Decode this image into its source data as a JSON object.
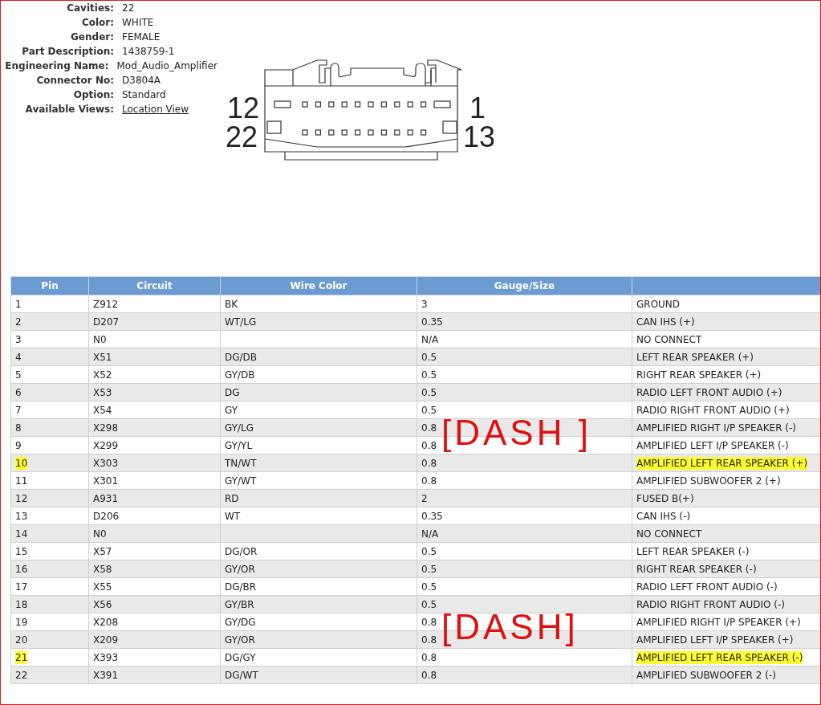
{
  "connector_info": [
    {
      "label": "Cavities:",
      "value": "22",
      "kind": "text"
    },
    {
      "label": "Color:",
      "value": "WHITE",
      "kind": "text"
    },
    {
      "label": "Gender:",
      "value": "FEMALE",
      "kind": "text"
    },
    {
      "label": "Part Description:",
      "value": "1438759-1",
      "kind": "text"
    },
    {
      "label": "Engineering Name:",
      "value": "Mod_Audio_Amplifier",
      "kind": "text"
    },
    {
      "label": "Connector No:",
      "value": "D3804A",
      "kind": "text"
    },
    {
      "label": "Option:",
      "value": "Standard",
      "kind": "text"
    },
    {
      "label": "Available Views:",
      "value": "Location View",
      "kind": "link"
    }
  ],
  "connector_diagram": {
    "pin_labels": [
      "12",
      "22",
      "1",
      "13"
    ]
  },
  "table": {
    "columns": [
      "Pin",
      "Circuit",
      "Wire Color",
      "Gauge/Size"
    ],
    "rows": [
      {
        "pin": "1",
        "circuit": "Z912",
        "wire_color": "BK",
        "gauge": "3",
        "function": "GROUND",
        "highlighted": false
      },
      {
        "pin": "2",
        "circuit": "D207",
        "wire_color": "WT/LG",
        "gauge": "0.35",
        "function": "CAN IHS (+)",
        "highlighted": false
      },
      {
        "pin": "3",
        "circuit": "N0",
        "gauge": "N/A",
        "function": "NO CONNECT",
        "highlighted": false
      },
      {
        "pin": "4",
        "circuit": "X51",
        "wire_color": "DG/DB",
        "gauge": "0.5",
        "function": "LEFT REAR SPEAKER (+)",
        "highlighted": false
      },
      {
        "pin": "5",
        "circuit": "X52",
        "wire_color": "GY/DB",
        "gauge": "0.5",
        "function": "RIGHT REAR SPEAKER (+)",
        "highlighted": false
      },
      {
        "pin": "6",
        "circuit": "X53",
        "wire_color": "DG",
        "gauge": "0.5",
        "function": "RADIO LEFT FRONT AUDIO (+)",
        "highlighted": false
      },
      {
        "pin": "7",
        "circuit": "X54",
        "wire_color": "GY",
        "gauge": "0.5",
        "function": "RADIO RIGHT FRONT AUDIO (+)",
        "highlighted": false
      },
      {
        "pin": "8",
        "circuit": "X298",
        "wire_color": "GY/LG",
        "gauge": "0.8",
        "function": "AMPLIFIED RIGHT I/P SPEAKER (-)",
        "highlighted": false,
        "annotation": "[DASH ]"
      },
      {
        "pin": "9",
        "circuit": "X299",
        "wire_color": "GY/YL",
        "gauge": "0.8",
        "function": "AMPLIFIED LEFT I/P SPEAKER (-)",
        "highlighted": false
      },
      {
        "pin": "10",
        "circuit": "X303",
        "wire_color": "TN/WT",
        "gauge": "0.8",
        "function": "AMPLIFIED LEFT REAR SPEAKER (+)",
        "highlighted": true
      },
      {
        "pin": "11",
        "circuit": "X301",
        "wire_color": "GY/WT",
        "gauge": "0.8",
        "function": "AMPLIFIED SUBWOOFER 2 (+)",
        "highlighted": false
      },
      {
        "pin": "12",
        "circuit": "A931",
        "wire_color": "RD",
        "gauge": "2",
        "function": "FUSED B(+)",
        "highlighted": false
      },
      {
        "pin": "13",
        "circuit": "D206",
        "wire_color": "WT",
        "gauge": "0.35",
        "function": "CAN IHS (-)",
        "highlighted": false
      },
      {
        "pin": "14",
        "circuit": "N0",
        "gauge": "N/A",
        "function": "NO CONNECT",
        "highlighted": false
      },
      {
        "pin": "15",
        "circuit": "X57",
        "wire_color": "DG/OR",
        "gauge": "0.5",
        "function": "LEFT REAR SPEAKER (-)",
        "highlighted": false
      },
      {
        "pin": "16",
        "circuit": "X58",
        "wire_color": "GY/OR",
        "gauge": "0.5",
        "function": "RIGHT REAR SPEAKER (-)",
        "highlighted": false
      },
      {
        "pin": "17",
        "circuit": "X55",
        "wire_color": "DG/BR",
        "gauge": "0.5",
        "function": "RADIO LEFT FRONT AUDIO (-)",
        "highlighted": false
      },
      {
        "pin": "18",
        "circuit": "X56",
        "wire_color": "GY/BR",
        "gauge": "0.5",
        "function": "RADIO RIGHT FRONT AUDIO (-)",
        "highlighted": false
      },
      {
        "pin": "19",
        "circuit": "X208",
        "wire_color": "GY/DG",
        "gauge": "0.8",
        "function": "AMPLIFIED RIGHT I/P SPEAKER (+)",
        "highlighted": false,
        "annotation": "[DASH]"
      },
      {
        "pin": "20",
        "circuit": "X209",
        "wire_color": "GY/OR",
        "gauge": "0.8",
        "function": "AMPLIFIED LEFT I/P SPEAKER (+)",
        "highlighted": false
      },
      {
        "pin": "21",
        "circuit": "X393",
        "wire_color": "DG/GY",
        "gauge": "0.8",
        "function": "AMPLIFIED LEFT REAR SPEAKER (-)",
        "highlighted": true
      },
      {
        "pin": "22",
        "circuit": "X391",
        "wire_color": "DG/WT",
        "gauge": "0.8",
        "function": "AMPLIFIED SUBWOOFER 2 (-)",
        "highlighted": false
      }
    ]
  }
}
